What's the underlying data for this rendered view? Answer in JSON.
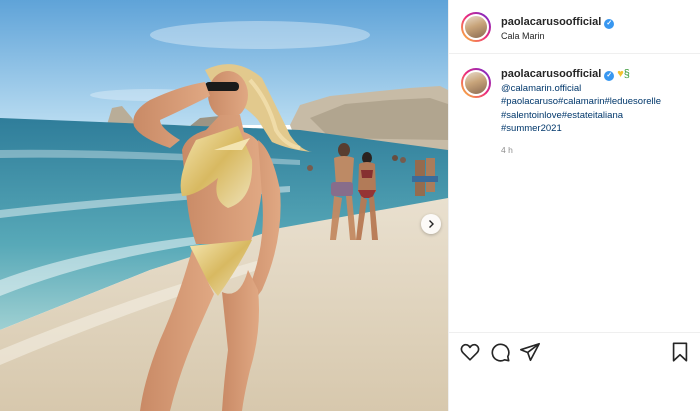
{
  "post": {
    "username": "paolacarusoofficial",
    "location": "Cala Marin",
    "verified": true
  },
  "caption": {
    "username": "paolacarusoofficial",
    "emojis": [
      "yellow-heart",
      "snake"
    ],
    "mention": "@calamarin.official",
    "hashtags": [
      "#paolacaruso#calamarin#leduesorelle",
      "#salentoinlove#estateitaliana",
      "#summer2021"
    ],
    "time_ago": "4 h"
  },
  "icons": {
    "like": "heart-icon",
    "comment": "comment-icon",
    "share": "share-icon",
    "save": "bookmark-icon",
    "next": "chevron-right-icon"
  },
  "colors": {
    "link": "#00376b",
    "verified": "#3897f0",
    "divider": "#efefef"
  }
}
